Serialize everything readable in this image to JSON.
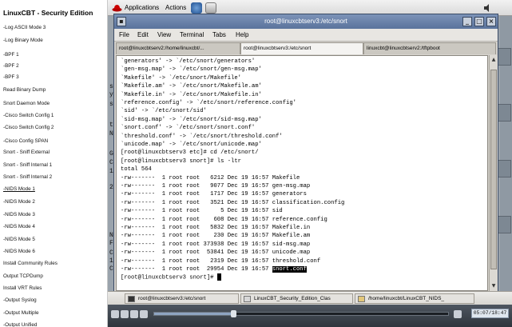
{
  "sidebar": {
    "title": "LinuxCBT - Security Edition",
    "items": [
      {
        "label": "-Log ASCII Mode 3"
      },
      {
        "label": "-Log Binary Mode"
      },
      {
        "label": "-BPF 1"
      },
      {
        "label": "-BPF 2"
      },
      {
        "label": "-BPF 3"
      },
      {
        "label": "Read Binary Dump"
      },
      {
        "label": "Snort Daemon Mode"
      },
      {
        "label": "-Cisco Switch Config 1"
      },
      {
        "label": "-Cisco Switch Config 2"
      },
      {
        "label": "-Cisco Config SPAN"
      },
      {
        "label": "Snort - Sniff External"
      },
      {
        "label": "Snort - Sniff Internal 1"
      },
      {
        "label": "Snort - Sniff Internal 2"
      },
      {
        "label": "-NIDS Mode 1"
      },
      {
        "label": "-NIDS Mode 2"
      },
      {
        "label": "-NIDS Mode 3"
      },
      {
        "label": "-NIDS Mode 4"
      },
      {
        "label": "-NIDS Mode 5"
      },
      {
        "label": "-NIDS Mode 6"
      },
      {
        "label": "Install Community Rules"
      },
      {
        "label": "Output TCPDump"
      },
      {
        "label": "Install VRT Rules"
      },
      {
        "label": "-Output Syslog"
      },
      {
        "label": "-Output Multiple"
      },
      {
        "label": "-Output Unified"
      }
    ],
    "active_index": 13
  },
  "topbar": {
    "applications": "Applications",
    "actions": "Actions",
    "clock": ""
  },
  "terminal": {
    "title": "root@linuxcbtserv3:/etc/snort",
    "menu": {
      "file": "File",
      "edit": "Edit",
      "view": "View",
      "terminal": "Terminal",
      "tabs": "Tabs",
      "help": "Help"
    },
    "tabs": [
      {
        "label": "root@linuxcbtserv2:/home/linuxcbt/..."
      },
      {
        "label": "root@linuxcbtserv3:/etc/snort"
      },
      {
        "label": "linuxcbt@linuxcbtserv2:/tftpboot"
      }
    ],
    "active_tab": 1,
    "lines": [
      "`generators' -> `/etc/snort/generators'",
      "`gen-msg.map' -> `/etc/snort/gen-msg.map'",
      "`Makefile' -> `/etc/snort/Makefile'",
      "`Makefile.am' -> `/etc/snort/Makefile.am'",
      "`Makefile.in' -> `/etc/snort/Makefile.in'",
      "`reference.config' -> `/etc/snort/reference.config'",
      "`sid' -> `/etc/snort/sid'",
      "`sid-msg.map' -> `/etc/snort/sid-msg.map'",
      "`snort.conf' -> `/etc/snort/snort.conf'",
      "`threshold.conf' -> `/etc/snort/threshold.conf'",
      "`unicode.map' -> `/etc/snort/unicode.map'",
      "[root@linuxcbtserv3 etc]# cd /etc/snort/",
      "[root@linuxcbtserv3 snort]# ls -ltr",
      "total 564",
      "-rw-------  1 root root   6212 Dec 19 16:57 Makefile",
      "-rw-------  1 root root   9077 Dec 19 16:57 gen-msg.map",
      "-rw-------  1 root root   1717 Dec 19 16:57 generators",
      "-rw-------  1 root root   3521 Dec 19 16:57 classification.config",
      "-rw-------  1 root root      5 Dec 19 16:57 sid",
      "-rw-------  1 root root    608 Dec 19 16:57 reference.config",
      "-rw-------  1 root root   5832 Dec 19 16:57 Makefile.in",
      "-rw-------  1 root root    230 Dec 19 16:57 Makefile.am",
      "-rw-------  1 root root 373938 Dec 19 16:57 sid-msg.map",
      "-rw-------  1 root root  53841 Dec 19 16:57 unicode.map",
      "-rw-------  1 root root   2319 Dec 19 16:57 threshold.conf",
      "-rw-------  1 root root  29954 Dec 19 16:57 "
    ],
    "last_file": "snort.conf",
    "prompt": "[root@linuxcbtserv3 snort]# "
  },
  "background_chars": [
    "s",
    "y",
    "s",
    "t",
    "N",
    "G",
    "C",
    "1",
    "2",
    "N",
    "F",
    "C",
    "1",
    "C"
  ],
  "taskbar": [
    {
      "label": "root@linuxcbtserv3:/etc/snort"
    },
    {
      "label": "LinuxCBT_Security_Edition_Clas"
    },
    {
      "label": "/home/linuxcbt/LinuxCBT_NIDS_"
    }
  ],
  "player": {
    "timecode": "05:07/18:47",
    "progress": 0.27
  }
}
